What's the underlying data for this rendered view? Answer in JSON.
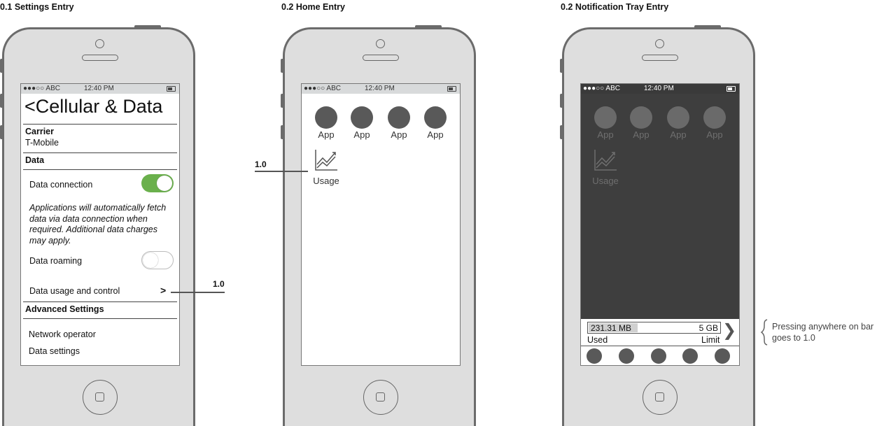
{
  "sections": {
    "settings": "0.1 Settings Entry",
    "home": "0.2 Home Entry",
    "tray": "0.2 Notification Tray Entry"
  },
  "status_bar": {
    "signal": "●●●○○ ABC",
    "time": "12:40 PM"
  },
  "settings_screen": {
    "title": "<Cellular & Data",
    "carrier_header": "Carrier",
    "carrier_value": "T-Mobile",
    "data_header": "Data",
    "data_connection_label": "Data connection",
    "data_connection_on": true,
    "data_description": "Applications will automatically fetch data via data connection when required. Additional data charges may apply.",
    "data_roaming_label": "Data roaming",
    "data_roaming_on": false,
    "data_usage_label": "Data usage and control",
    "data_usage_chevron": ">",
    "advanced_header": "Advanced Settings",
    "network_operator": "Network operator",
    "data_settings": "Data settings"
  },
  "home_screen": {
    "apps": [
      "App",
      "App",
      "App",
      "App"
    ],
    "usage_label": "Usage"
  },
  "tray_screen": {
    "used_value": "231.31 MB",
    "limit_value": "5 GB",
    "used_label": "Used",
    "limit_label": "Limit",
    "chevron": "❯",
    "dock_count": 5
  },
  "callouts": {
    "settings_link": "1.0",
    "home_link": "1.0",
    "tray_note": "Pressing anywhere on bar goes to 1.0"
  },
  "colors": {
    "toggle_on": "#6ab04c",
    "dark_overlay": "#3e3e3e"
  }
}
